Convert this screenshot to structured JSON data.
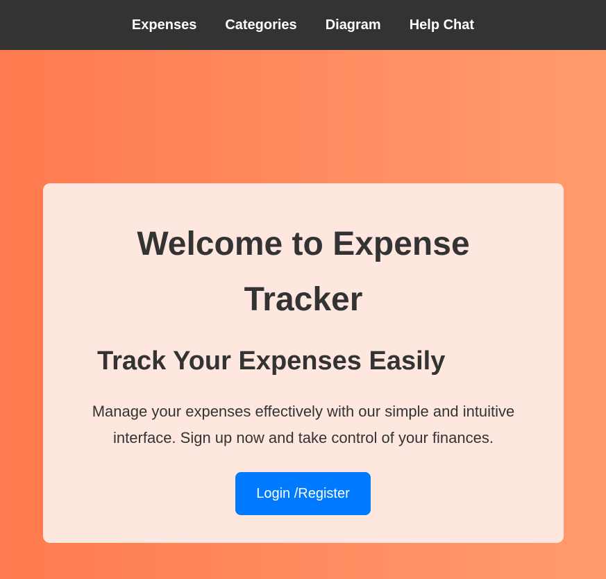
{
  "nav": {
    "items": [
      {
        "label": "Expenses"
      },
      {
        "label": "Categories"
      },
      {
        "label": "Diagram"
      },
      {
        "label": "Help Chat"
      }
    ]
  },
  "hero": {
    "title": "Welcome to Expense Tracker",
    "subtitle": "Track Your Expenses Easily",
    "description": "Manage your expenses effectively with our simple and intuitive interface. Sign up now and take control of your finances.",
    "cta_label": "Login /Register"
  },
  "colors": {
    "navbar_bg": "#333333",
    "card_bg": "#fde7df",
    "cta_bg": "#007bff",
    "gradient_start": "#ff7a4f",
    "gradient_end": "#ff9a6c"
  }
}
